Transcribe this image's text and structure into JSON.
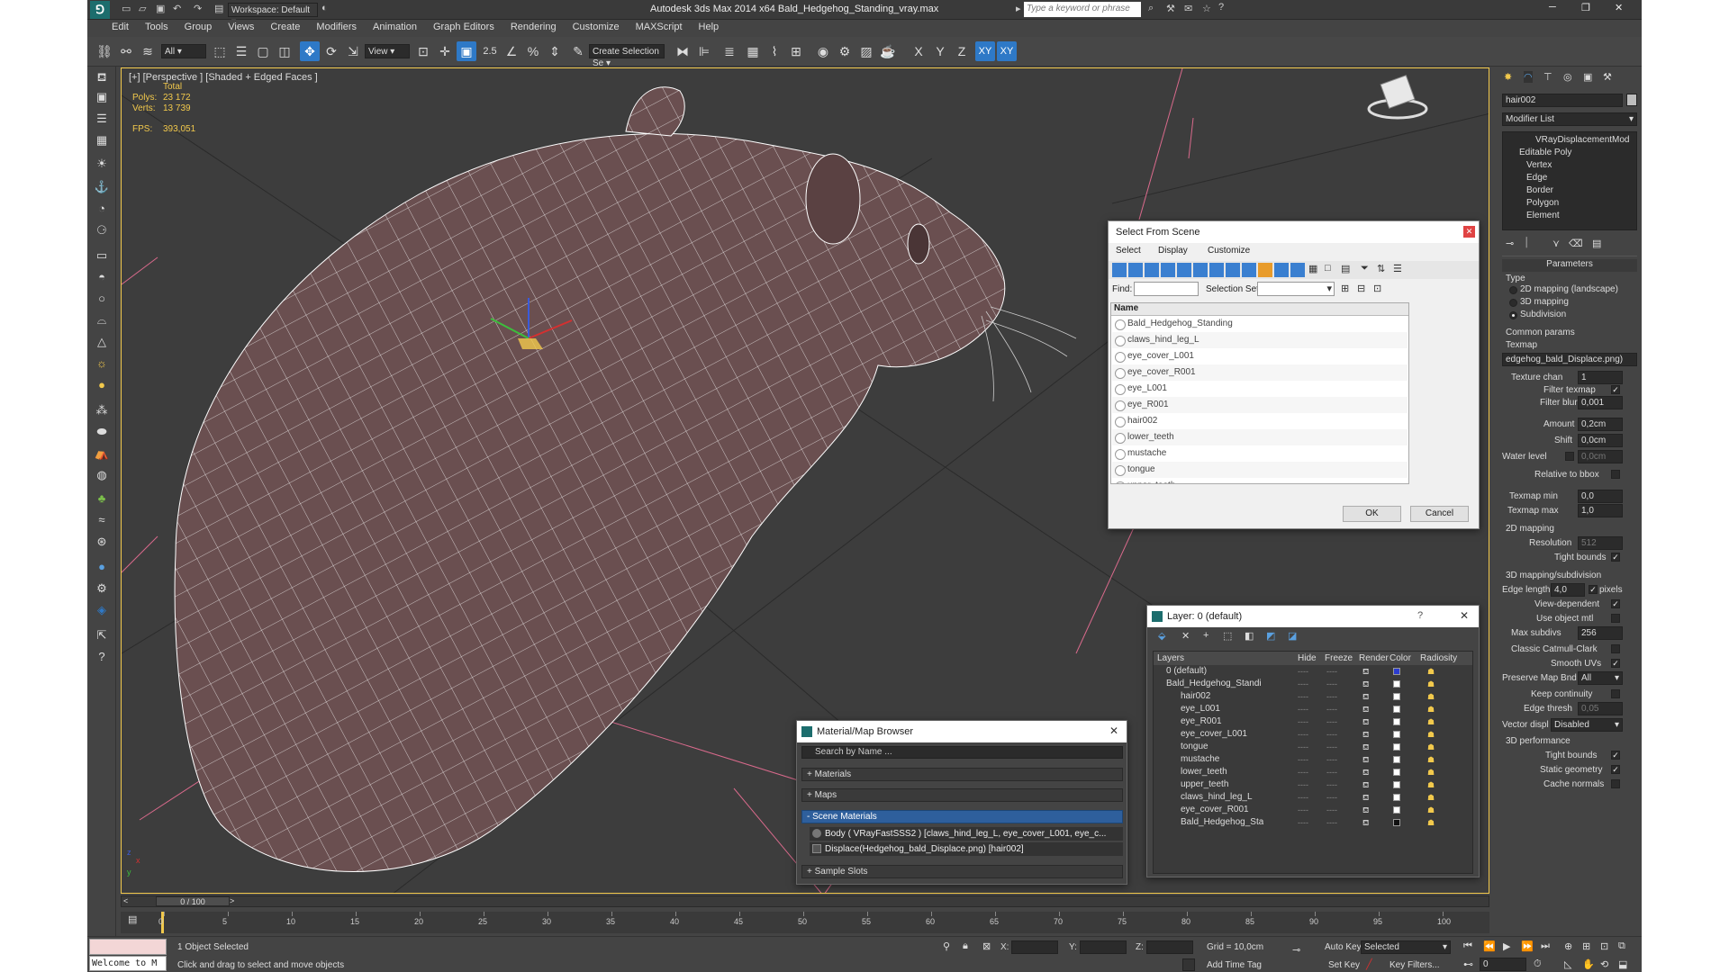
{
  "titlebar": {
    "workspace": "Workspace: Default",
    "title": "Autodesk 3ds Max  2014 x64     Bald_Hedgehog_Standing_vray.max",
    "search_placeholder": "Type a keyword or phrase"
  },
  "menu": [
    "Edit",
    "Tools",
    "Group",
    "Views",
    "Create",
    "Modifiers",
    "Animation",
    "Graph Editors",
    "Rendering",
    "Customize",
    "MAXScript",
    "Help"
  ],
  "toolbar": {
    "filter": "All",
    "refcoord": "View",
    "selection_set": "Create Selection Se",
    "axes": [
      "X",
      "Y",
      "Z",
      "XY",
      "XY"
    ],
    "snap_label": "2.5"
  },
  "viewport": {
    "label": "[+] [Perspective ] [Shaded + Edged Faces ]",
    "stats_total": "Total",
    "polys_label": "Polys:",
    "polys_value": "23 172",
    "verts_label": "Verts:",
    "verts_value": "13 739",
    "fps_label": "FPS:",
    "fps_value": "393,051",
    "axes": [
      "x",
      "y",
      "z"
    ]
  },
  "select_from_scene": {
    "title": "Select From Scene",
    "menu": [
      "Select",
      "Display",
      "Customize"
    ],
    "find_label": "Find:",
    "selset_label": "Selection Set:",
    "column": "Name",
    "items": [
      "Bald_Hedgehog_Standing",
      "claws_hind_leg_L",
      "eye_cover_L001",
      "eye_cover_R001",
      "eye_L001",
      "eye_R001",
      "hair002",
      "lower_teeth",
      "mustache",
      "tongue",
      "upper_teeth"
    ],
    "ok": "OK",
    "cancel": "Cancel"
  },
  "layer_dialog": {
    "title": "Layer: 0 (default)",
    "help": "?",
    "columns": [
      "Layers",
      "Hide",
      "Freeze",
      "Render",
      "Color",
      "Radiosity"
    ],
    "rows": [
      "0 (default)",
      "Bald_Hedgehog_Standi",
      "hair002",
      "eye_L001",
      "eye_R001",
      "eye_cover_L001",
      "tongue",
      "mustache",
      "lower_teeth",
      "upper_teeth",
      "claws_hind_leg_L",
      "eye_cover_R001",
      "Bald_Hedgehog_Sta"
    ],
    "dashes": "----"
  },
  "material_browser": {
    "title": "Material/Map Browser",
    "search": "Search by Name ...",
    "sections": [
      "+ Materials",
      "+ Maps",
      "- Scene Materials",
      "+ Sample Slots"
    ],
    "scene_items": [
      "Body  ( VRayFastSSS2 ) [claws_hind_leg_L, eye_cover_L001, eye_c...",
      "Displace(Hedgehog_bald_Displace.png) [hair002]"
    ]
  },
  "command_panel": {
    "object_name": "hair002",
    "modifier_list": "Modifier List",
    "stack": [
      "VRayDisplacementMod",
      "Editable Poly",
      "Vertex",
      "Edge",
      "Border",
      "Polygon",
      "Element"
    ],
    "parameters": "Parameters",
    "type_label": "Type",
    "types": [
      "2D mapping (landscape)",
      "3D mapping",
      "Subdivision"
    ],
    "common": "Common params",
    "texmap_label": "Texmap",
    "texmap_value": "edgehog_bald_Displace.png)",
    "texture_chan_label": "Texture chan",
    "texture_chan": "1",
    "filter_texmap": "Filter texmap",
    "filter_blur_label": "Filter blur",
    "filter_blur": "0,001",
    "amount_label": "Amount",
    "amount": "0,2cm",
    "shift_label": "Shift",
    "shift": "0,0cm",
    "water_label": "Water level",
    "water": "0,0cm",
    "relative": "Relative to bbox",
    "texmap_min_label": "Texmap min",
    "texmap_min": "0,0",
    "texmap_max_label": "Texmap max",
    "texmap_max": "1,0",
    "map2d": "2D mapping",
    "resolution_label": "Resolution",
    "resolution": "512",
    "tight_bounds": "Tight bounds",
    "map3d": "3D mapping/subdivision",
    "edge_length_label": "Edge length",
    "edge_length": "4,0",
    "pixels": "pixels",
    "view_dependent": "View-dependent",
    "use_object_mtl": "Use object mtl",
    "max_subdivs_label": "Max subdivs",
    "max_subdivs": "256",
    "catmull": "Classic Catmull-Clark",
    "smooth_uvs": "Smooth UVs",
    "preserve_label": "Preserve Map Bnd",
    "preserve": "All",
    "keep_continuity": "Keep continuity",
    "edge_thresh_label": "Edge thresh",
    "edge_thresh": "0,05",
    "vector_label": "Vector displ",
    "vector": "Disabled",
    "perf": "3D performance",
    "tight_bounds2": "Tight bounds",
    "static_geometry": "Static geometry",
    "cache_normals": "Cache normals"
  },
  "timeline": {
    "frame": "0 / 100",
    "ticks": [
      "0",
      "5",
      "10",
      "15",
      "20",
      "25",
      "30",
      "35",
      "40",
      "45",
      "50",
      "55",
      "60",
      "65",
      "70",
      "75",
      "80",
      "85",
      "90",
      "95",
      "100"
    ]
  },
  "status": {
    "script": "Welcome to M",
    "selected": "1 Object Selected",
    "prompt": "Click and drag to select and move objects",
    "x_label": "X:",
    "y_label": "Y:",
    "z_label": "Z:",
    "grid": "Grid = 10,0cm",
    "auto_key": "Auto Key",
    "selected_dd": "Selected",
    "set_key": "Set Key",
    "key_filters": "Key Filters...",
    "add_time_tag": "Add Time Tag",
    "frame_field": "0"
  }
}
